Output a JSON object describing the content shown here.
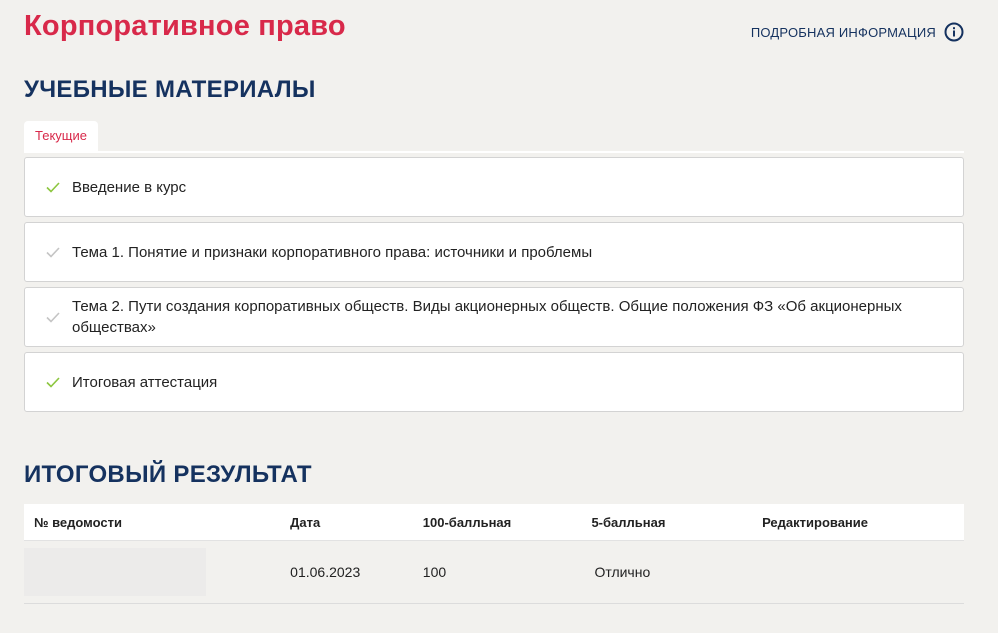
{
  "header": {
    "course_title": "Корпоративное право",
    "more_info_label": "ПОДРОБНАЯ ИНФОРМАЦИЯ",
    "info_icon": "info-circle-icon"
  },
  "materials": {
    "heading": "УЧЕБНЫЕ МАТЕРИАЛЫ",
    "tab_label": "Текущие",
    "items": [
      {
        "label": "Введение в курс",
        "status": "completed",
        "check_color": "#8cc63f"
      },
      {
        "label": "Тема 1. Понятие и признаки корпоративного права: источники и проблемы",
        "status": "pending",
        "check_color": "#c4c4c4"
      },
      {
        "label": "Тема 2. Пути создания корпоративных обществ. Виды акционерных обществ. Общие положения ФЗ «Об акционерных обществах»",
        "status": "pending",
        "check_color": "#c4c4c4"
      },
      {
        "label": "Итоговая аттестация",
        "status": "completed",
        "check_color": "#8cc63f"
      }
    ]
  },
  "results": {
    "heading": "ИТОГОВЫЙ РЕЗУЛЬТАТ",
    "columns": [
      "№ ведомости",
      "Дата",
      "100-балльная",
      "5-балльная",
      "Редактирование"
    ],
    "rows": [
      {
        "sheet_no": "",
        "date": "01.06.2023",
        "score_100": "100",
        "score_5": "Отлично",
        "edit": ""
      }
    ]
  },
  "colors": {
    "accent_red": "#d8294a",
    "navy": "#15325f",
    "check_green": "#8cc63f",
    "check_gray": "#c4c4c4",
    "background": "#f2f1ee"
  }
}
